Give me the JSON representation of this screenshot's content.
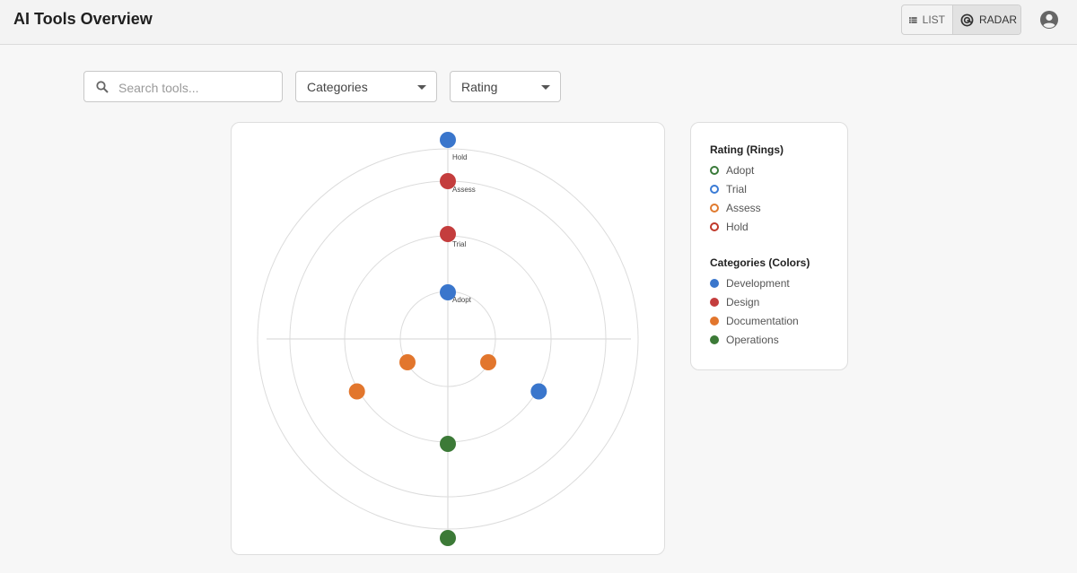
{
  "header": {
    "title": "AI Tools Overview",
    "view_toggle": {
      "list_label": "LIST",
      "radar_label": "RADAR",
      "active": "RADAR"
    }
  },
  "filters": {
    "search_placeholder": "Search tools...",
    "search_value": "",
    "categories_label": "Categories",
    "rating_label": "Rating"
  },
  "radar": {
    "ring_labels": [
      "Adopt",
      "Trial",
      "Assess",
      "Hold"
    ],
    "blips": [
      {
        "category": "Development",
        "ring": "Hold",
        "angle_deg": 0
      },
      {
        "category": "Design",
        "ring": "Assess",
        "angle_deg": 0
      },
      {
        "category": "Design",
        "ring": "Trial",
        "angle_deg": 0
      },
      {
        "category": "Development",
        "ring": "Adopt",
        "angle_deg": 0
      },
      {
        "category": "Documentation",
        "ring": "Adopt",
        "angle_deg": 240
      },
      {
        "category": "Documentation",
        "ring": "Adopt",
        "angle_deg": 120
      },
      {
        "category": "Documentation",
        "ring": "Trial",
        "angle_deg": 240
      },
      {
        "category": "Development",
        "ring": "Trial",
        "angle_deg": 120
      },
      {
        "category": "Operations",
        "ring": "Trial",
        "angle_deg": 180
      },
      {
        "category": "Operations",
        "ring": "Hold",
        "angle_deg": 180
      }
    ]
  },
  "legend": {
    "rings_title": "Rating (Rings)",
    "rings": [
      {
        "label": "Adopt",
        "color": "#3a7a3a"
      },
      {
        "label": "Trial",
        "color": "#3a7bd5"
      },
      {
        "label": "Assess",
        "color": "#e07a2e"
      },
      {
        "label": "Hold",
        "color": "#c0392b"
      }
    ],
    "categories_title": "Categories (Colors)",
    "categories": [
      {
        "label": "Development",
        "color": "#3a76cc"
      },
      {
        "label": "Design",
        "color": "#c43d3d"
      },
      {
        "label": "Documentation",
        "color": "#e2762d"
      },
      {
        "label": "Operations",
        "color": "#3c7a37"
      }
    ]
  }
}
